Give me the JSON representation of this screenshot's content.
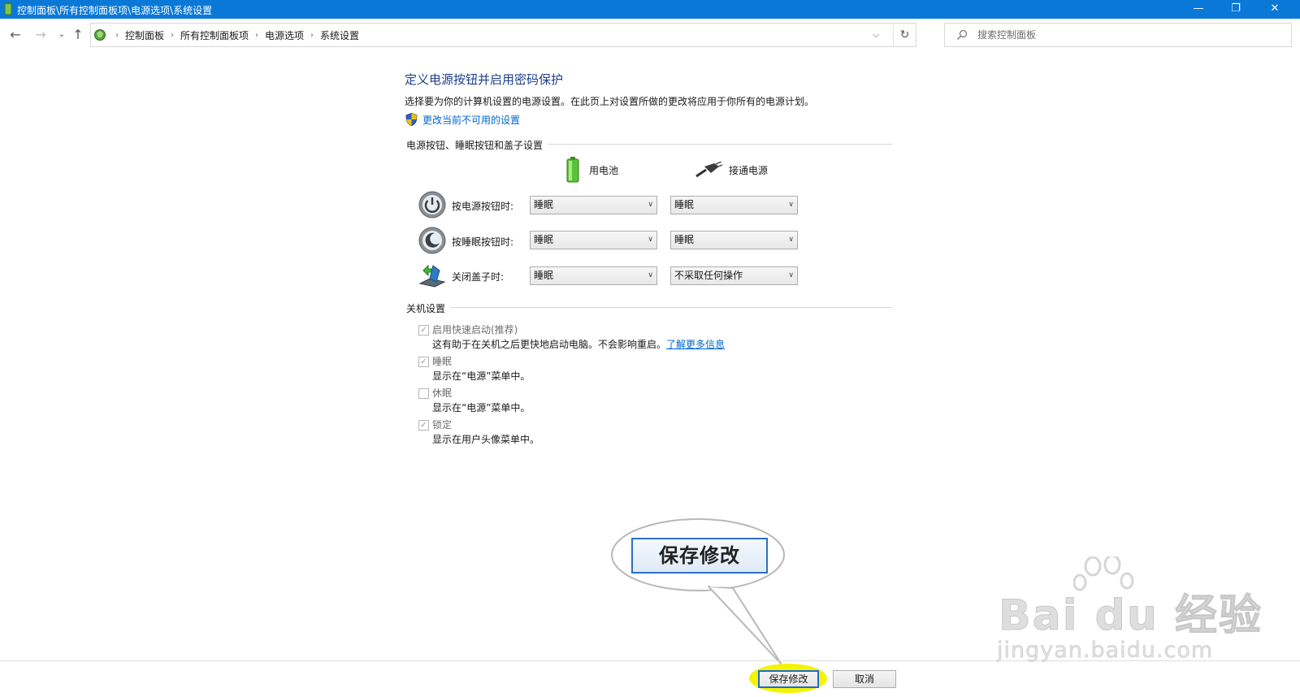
{
  "window": {
    "title": "控制面板\\所有控制面板项\\电源选项\\系统设置",
    "minimize_glyph": "—",
    "maximize_glyph": "❐",
    "close_glyph": "✕"
  },
  "nav": {
    "back_icon": "arrow-left-icon",
    "forward_icon": "arrow-right-icon",
    "up_icon": "arrow-up-icon",
    "breadcrumbs": [
      "控制面板",
      "所有控制面板项",
      "电源选项",
      "系统设置"
    ],
    "search_placeholder": "搜索控制面板"
  },
  "page": {
    "title": "定义电源按钮并启用密码保护",
    "description": "选择要为你的计算机设置的电源设置。在此页上对设置所做的更改将应用于你所有的电源计划。",
    "change_link": "更改当前不可用的设置"
  },
  "power_section": {
    "heading": "电源按钮、睡眠按钮和盖子设置",
    "col_battery": "用电池",
    "col_plugged": "接通电源",
    "rows": [
      {
        "label": "按电源按钮时:",
        "battery": "睡眠",
        "plugged": "睡眠"
      },
      {
        "label": "按睡眠按钮时:",
        "battery": "睡眠",
        "plugged": "睡眠"
      },
      {
        "label": "关闭盖子时:",
        "battery": "睡眠",
        "plugged": "不采取任何操作"
      }
    ]
  },
  "shutdown_section": {
    "heading": "关机设置",
    "items": [
      {
        "label": "启用快速启动(推荐)",
        "checked": true,
        "desc": "这有助于在关机之后更快地启动电脑。不会影响重启。",
        "link": "了解更多信息"
      },
      {
        "label": "睡眠",
        "checked": true,
        "desc": "显示在“电源”菜单中。"
      },
      {
        "label": "休眠",
        "checked": false,
        "desc": "显示在“电源”菜单中。"
      },
      {
        "label": "锁定",
        "checked": true,
        "desc": "显示在用户头像菜单中。"
      }
    ]
  },
  "callout": {
    "text": "保存修改"
  },
  "footer": {
    "save_label": "保存修改",
    "cancel_label": "取消"
  },
  "watermark": {
    "logo": "Bai du 经验",
    "url": "jingyan.baidu.com"
  },
  "colors": {
    "titlebar": "#0a78d7",
    "heading": "#1e3f8c",
    "link": "#0066cc",
    "highlight": "#f4f300"
  }
}
